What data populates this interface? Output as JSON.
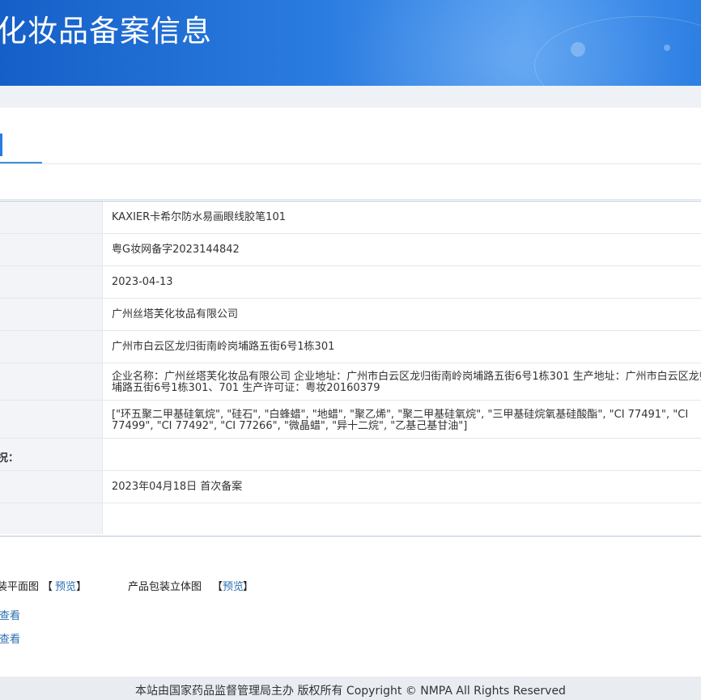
{
  "header": {
    "title": "化妆品备案信息"
  },
  "rows": [
    {
      "label": "",
      "value": "KAXIER卡希尔防水易画眼线胶笔101"
    },
    {
      "label": "",
      "value": "粤G妆网备字2023144842"
    },
    {
      "label": "",
      "value": "2023-04-13"
    },
    {
      "label": "",
      "value": "广州丝塔芙化妆品有限公司"
    },
    {
      "label": "",
      "value": "广州市白云区龙归街南岭岗埔路五街6号1栋301"
    },
    {
      "label": "",
      "value_line1": "企业名称：广州丝塔芙化妆品有限公司 企业地址：广州市白云区龙归街南岭岗埔路五街6号1栋301 生产地址：广州市白云区龙归街南岭岗",
      "value_line2": "埔路五街6号1栋301、701 生产许可证：粤妆20160379"
    },
    {
      "label": "",
      "value_line1": "[\"环五聚二甲基硅氧烷\", \"硅石\", \"白蜂蜡\", \"地蜡\", \"聚乙烯\", \"聚二甲基硅氧烷\", \"三甲基硅烷氧基硅酸酯\", \"CI 77491\", \"CI",
      "value_line2": "77499\", \"CI 77492\", \"CI 77266\", \"微晶蜡\", \"异十二烷\", \"乙基己基甘油\"]"
    },
    {
      "label": "况：",
      "value": ""
    },
    {
      "label": "",
      "value": "2023年04月18日 首次备案"
    },
    {
      "label": "",
      "value": ""
    }
  ],
  "packaging": {
    "flat_label": "装平面图",
    "flat_link": "预览",
    "solid_label": "产品包装立体图",
    "solid_link": "预览",
    "bracket_open": "【",
    "bracket_close": "】"
  },
  "view_links": [
    {
      "label": "查看"
    },
    {
      "label": "查看"
    }
  ],
  "footer": {
    "text": "本站由国家药品监督管理局主办 版权所有 Copyright © NMPA All Rights Reserved"
  },
  "colors": {
    "banner": "#2a7be0",
    "link": "#2a6fb0",
    "label_bg": "#f2f4f7"
  }
}
